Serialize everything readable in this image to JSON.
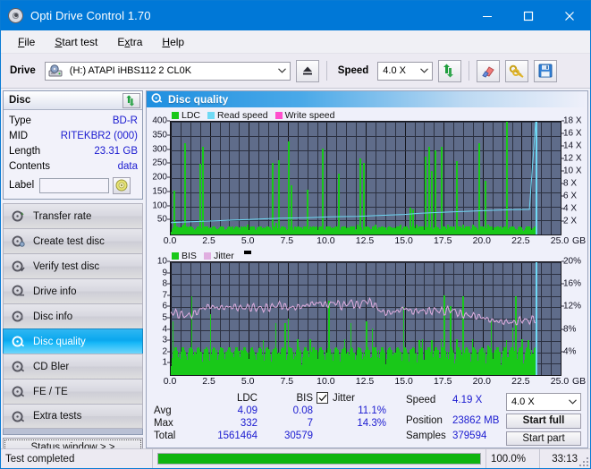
{
  "window": {
    "title": "Opti Drive Control 1.70",
    "icon": "disc-icon",
    "minimize": "–",
    "maximize": "□",
    "close": "✕"
  },
  "menu": {
    "items": [
      {
        "label": "File",
        "accel": "F"
      },
      {
        "label": "Start test",
        "accel": "S"
      },
      {
        "label": "Extra",
        "accel": "x"
      },
      {
        "label": "Help",
        "accel": "H"
      }
    ]
  },
  "toolbar": {
    "drive_label": "Drive",
    "drive_value": "(H:)  ATAPI iHBS112  2 CL0K",
    "eject_icon": "eject-icon",
    "speed_label": "Speed",
    "speed_value": "4.0 X",
    "refresh_icon": "refresh-icon",
    "erase_icon": "eraser-icon",
    "keys_icon": "keys-icon",
    "save_icon": "save-icon"
  },
  "disc_panel": {
    "title": "Disc",
    "refresh_icon": "refresh-icon",
    "rows": [
      {
        "key": "Type",
        "value": "BD-R"
      },
      {
        "key": "MID",
        "value": "RITEKBR2 (000)"
      },
      {
        "key": "Length",
        "value": "23.31 GB"
      },
      {
        "key": "Contents",
        "value": "data"
      }
    ],
    "label_key": "Label",
    "label_value": "",
    "label_placeholder": "",
    "label_button_icon": "disc-icon"
  },
  "sidebar": {
    "items": [
      {
        "label": "Transfer rate",
        "icon": "disc-test-icon",
        "selected": false
      },
      {
        "label": "Create test disc",
        "icon": "disc-write-icon",
        "selected": false
      },
      {
        "label": "Verify test disc",
        "icon": "disc-verify-icon",
        "selected": false
      },
      {
        "label": "Drive info",
        "icon": "drive-info-icon",
        "selected": false
      },
      {
        "label": "Disc info",
        "icon": "disc-info-icon",
        "selected": false
      },
      {
        "label": "Disc quality",
        "icon": "disc-quality-icon",
        "selected": true
      },
      {
        "label": "CD Bler",
        "icon": "cd-bler-icon",
        "selected": false
      },
      {
        "label": "FE / TE",
        "icon": "fe-te-icon",
        "selected": false
      },
      {
        "label": "Extra tests",
        "icon": "extra-tests-icon",
        "selected": false
      }
    ],
    "status_window_button": "Status window > >"
  },
  "panel": {
    "title": "Disc quality",
    "icon": "disc-quality-icon"
  },
  "stats": {
    "col_ldc": "LDC",
    "col_bis": "BIS",
    "jitter_label": "Jitter",
    "jitter_checked": true,
    "row_avg": "Avg",
    "row_max": "Max",
    "row_total": "Total",
    "ldc_avg": "4.09",
    "ldc_max": "332",
    "ldc_total": "1561464",
    "bis_avg": "0.08",
    "bis_max": "7",
    "bis_total": "30579",
    "jitter_avg": "11.1%",
    "jitter_max": "14.3%",
    "speed_label": "Speed",
    "speed_value": "4.19 X",
    "position_label": "Position",
    "position_value": "23862 MB",
    "samples_label": "Samples",
    "samples_value": "379594",
    "speed_select": "4.0 X",
    "start_full": "Start full",
    "start_part": "Start part"
  },
  "statusbar": {
    "message": "Test completed",
    "progress_text": "100.0%",
    "progress_value": 100,
    "elapsed": "33:13"
  },
  "colors": {
    "accent": "#0078d7",
    "ldc": "#19c819",
    "bis": "#19c819",
    "read_speed": "#6fd9f5",
    "write_speed": "#ff4ecd",
    "jitter": "#e0aee0",
    "plot_bg": "#5f6c8a",
    "value_text": "#1a1ad0"
  },
  "chart_data": [
    {
      "type": "line",
      "title": "LDC / Read speed",
      "xlabel": "GB",
      "ylabel": "LDC",
      "xlim": [
        0,
        25
      ],
      "xticks": [
        0.0,
        2.5,
        5.0,
        7.5,
        10.0,
        12.5,
        15.0,
        17.5,
        20.0,
        22.5,
        25.0
      ],
      "xticklabels": [
        "0.0",
        "2.5",
        "5.0",
        "7.5",
        "10.0",
        "12.5",
        "15.0",
        "17.5",
        "20.0",
        "22.5",
        "25.0"
      ],
      "xunit": "GB",
      "ylim": [
        0,
        400
      ],
      "yticks": [
        50,
        100,
        150,
        200,
        250,
        300,
        350,
        400
      ],
      "y2lim": [
        0,
        18
      ],
      "y2ticks": [
        2,
        4,
        6,
        8,
        10,
        12,
        14,
        16,
        18
      ],
      "y2ticklabels": [
        "2 X",
        "4 X",
        "6 X",
        "8 X",
        "10 X",
        "12 X",
        "14 X",
        "16 X",
        "18 X"
      ],
      "grid": true,
      "legend": [
        {
          "name": "LDC",
          "color": "#19c819"
        },
        {
          "name": "Read speed",
          "color": "#6fd9f5"
        },
        {
          "name": "Write speed",
          "color": "#ff4ecd"
        }
      ],
      "series": [
        {
          "name": "LDC",
          "type": "bar",
          "color": "#19c819",
          "x": [
            0.05,
            0.15,
            0.25,
            0.35,
            0.45,
            0.55,
            0.65,
            0.75,
            0.85,
            0.95,
            1.1,
            1.25,
            1.4,
            1.55,
            1.7,
            1.85,
            2.0,
            2.15,
            2.3,
            2.45,
            2.6,
            2.75,
            2.9,
            3.1,
            3.3,
            3.5,
            3.7,
            3.9,
            4.1,
            4.3,
            4.5,
            4.7,
            4.9,
            5.1,
            5.3,
            5.5,
            5.7,
            5.9,
            6.1,
            6.3,
            6.5,
            6.7,
            6.9,
            7.1,
            7.3,
            7.5,
            7.7,
            7.9,
            8.1,
            8.3,
            8.5,
            8.7,
            8.9,
            9.1,
            9.3,
            9.5,
            9.7,
            9.9,
            10.1,
            10.3,
            10.5,
            10.7,
            10.9,
            11.1,
            11.3,
            11.5,
            11.7,
            11.9,
            12.1,
            12.3,
            12.5,
            12.7,
            12.9,
            13.1,
            13.3,
            13.5,
            13.7,
            13.9,
            14.1,
            14.3,
            14.5,
            14.7,
            14.9,
            15.1,
            15.3,
            15.5,
            15.7,
            15.9,
            16.1,
            16.3,
            16.5,
            16.7,
            16.9,
            17.1,
            17.3,
            17.5,
            17.7,
            17.9,
            18.1,
            18.3,
            18.5,
            18.7,
            18.9,
            19.1,
            19.3,
            19.5,
            19.7,
            19.9,
            20.1,
            20.3,
            20.5,
            20.7,
            20.9,
            21.1,
            21.3,
            21.5,
            21.7,
            21.9,
            22.1,
            22.3,
            22.5,
            22.7,
            22.9,
            23.1,
            23.3
          ],
          "values": [
            20,
            155,
            40,
            30,
            25,
            25,
            25,
            35,
            325,
            30,
            25,
            25,
            20,
            20,
            25,
            250,
            310,
            30,
            25,
            25,
            20,
            25,
            20,
            25,
            25,
            20,
            25,
            30,
            25,
            25,
            30,
            25,
            35,
            25,
            30,
            25,
            25,
            25,
            30,
            25,
            255,
            40,
            265,
            30,
            25,
            330,
            175,
            30,
            25,
            25,
            30,
            160,
            30,
            25,
            30,
            25,
            305,
            30,
            25,
            25,
            30,
            215,
            25,
            30,
            25,
            25,
            30,
            35,
            270,
            255,
            30,
            25,
            30,
            35,
            25,
            30,
            25,
            25,
            25,
            25,
            30,
            35,
            30,
            30,
            95,
            90,
            35,
            30,
            30,
            275,
            310,
            225,
            300,
            25,
            310,
            30,
            35,
            25,
            30,
            260,
            30,
            35,
            25,
            30,
            35,
            25,
            325,
            30,
            190,
            35,
            30,
            25,
            30,
            30,
            25,
            400,
            25,
            20,
            20,
            20,
            20
          ]
        },
        {
          "name": "Read speed",
          "type": "line",
          "color": "#6fd9f5",
          "x": [
            0.0,
            1.0,
            2.0,
            3.0,
            4.0,
            5.0,
            6.0,
            7.0,
            8.0,
            9.0,
            10.0,
            11.0,
            12.0,
            13.0,
            14.0,
            15.0,
            16.0,
            17.0,
            18.0,
            19.0,
            20.0,
            21.0,
            22.0,
            23.0,
            23.4
          ],
          "values": [
            1.9,
            2.0,
            2.1,
            2.2,
            2.3,
            2.4,
            2.5,
            2.6,
            2.65,
            2.7,
            2.8,
            2.85,
            2.9,
            3.0,
            3.1,
            3.2,
            3.4,
            3.5,
            3.6,
            3.7,
            3.8,
            3.9,
            3.95,
            4.0,
            18.0
          ]
        }
      ]
    },
    {
      "type": "line",
      "title": "BIS / Jitter",
      "xlabel": "GB",
      "ylabel": "BIS",
      "xlim": [
        0,
        25
      ],
      "xticks": [
        0.0,
        2.5,
        5.0,
        7.5,
        10.0,
        12.5,
        15.0,
        17.5,
        20.0,
        22.5,
        25.0
      ],
      "xticklabels": [
        "0.0",
        "2.5",
        "5.0",
        "7.5",
        "10.0",
        "12.5",
        "15.0",
        "17.5",
        "20.0",
        "22.5",
        "25.0"
      ],
      "xunit": "GB",
      "ylim": [
        0,
        10
      ],
      "yticks": [
        1,
        2,
        3,
        4,
        5,
        6,
        7,
        8,
        9,
        10
      ],
      "y2lim": [
        0,
        20
      ],
      "y2ticks": [
        4,
        8,
        12,
        16,
        20
      ],
      "y2ticklabels": [
        "4%",
        "8%",
        "12%",
        "16%",
        "20%"
      ],
      "grid": true,
      "legend": [
        {
          "name": "BIS",
          "color": "#19c819"
        },
        {
          "name": "Jitter",
          "color": "#e0aee0"
        }
      ],
      "series": [
        {
          "name": "BIS",
          "type": "bar",
          "color": "#19c819",
          "x": [
            0.1,
            0.3,
            0.5,
            0.7,
            0.9,
            1.1,
            1.3,
            1.5,
            1.7,
            1.9,
            2.1,
            2.3,
            2.5,
            2.7,
            2.9,
            3.1,
            3.3,
            3.5,
            3.7,
            3.9,
            4.1,
            4.3,
            4.5,
            4.7,
            4.9,
            5.1,
            5.3,
            5.5,
            5.7,
            5.9,
            6.1,
            6.3,
            6.5,
            6.7,
            6.9,
            7.1,
            7.3,
            7.5,
            7.7,
            7.9,
            8.1,
            8.3,
            8.5,
            8.7,
            8.9,
            9.1,
            9.3,
            9.5,
            9.7,
            9.9,
            10.1,
            10.3,
            10.5,
            10.7,
            10.9,
            11.1,
            11.3,
            11.5,
            11.7,
            11.9,
            12.1,
            12.3,
            12.5,
            12.7,
            12.9,
            13.1,
            13.3,
            13.5,
            13.7,
            13.9,
            14.1,
            14.3,
            14.5,
            14.7,
            14.9,
            15.1,
            15.3,
            15.5,
            15.7,
            15.9,
            16.1,
            16.3,
            16.5,
            16.7,
            16.9,
            17.1,
            17.3,
            17.5,
            17.7,
            17.9,
            18.1,
            18.3,
            18.5,
            18.7,
            18.9,
            19.1,
            19.3,
            19.5,
            19.7,
            19.9,
            20.1,
            20.3,
            20.5,
            20.7,
            20.9,
            21.1,
            21.3,
            21.5,
            21.7,
            21.9,
            22.1,
            22.3,
            22.5,
            22.7,
            22.9,
            23.1,
            23.3
          ],
          "values": [
            4.8,
            2.4,
            2.0,
            1.9,
            2.1,
            2.0,
            7.0,
            2.1,
            2.0,
            2.1,
            2.0,
            2.2,
            5.4,
            2.0,
            2.2,
            2.0,
            2.0,
            2.1,
            2.2,
            2.0,
            2.1,
            2.0,
            2.2,
            2.1,
            2.0,
            2.0,
            2.1,
            2.0,
            2.2,
            3.1,
            2.0,
            2.2,
            2.1,
            4.6,
            2.0,
            2.2,
            4.6,
            5.0,
            2.1,
            2.0,
            3.2,
            2.2,
            2.1,
            2.0,
            3.2,
            2.0,
            2.2,
            2.1,
            2.0,
            2.2,
            6.6,
            2.0,
            2.1,
            2.2,
            2.0,
            3.2,
            2.1,
            4.6,
            2.0,
            2.2,
            2.1,
            2.0,
            4.8,
            2.2,
            4.1,
            2.0,
            2.2,
            2.1,
            2.0,
            2.2,
            2.1,
            2.0,
            2.2,
            2.1,
            6.0,
            2.0,
            2.2,
            2.1,
            2.0,
            3.1,
            3.2,
            2.2,
            2.1,
            3.1,
            2.0,
            2.2,
            3.2,
            7.1,
            2.1,
            6.1,
            2.0,
            3.2,
            2.2,
            7.0,
            2.1,
            2.0,
            3.2,
            2.2,
            2.1,
            2.0,
            2.2,
            2.6,
            4.9,
            2.0,
            2.2,
            2.1,
            2.0,
            3.1,
            2.2,
            4.2,
            7.0,
            2.1,
            3.2,
            2.0,
            3.1,
            2.2,
            2.0
          ]
        },
        {
          "name": "Jitter",
          "type": "line",
          "color": "#e0aee0",
          "x": [
            0.0,
            0.5,
            1.0,
            1.5,
            2.0,
            2.5,
            3.0,
            3.5,
            4.0,
            4.5,
            5.0,
            5.5,
            6.0,
            6.5,
            7.0,
            7.5,
            8.0,
            8.5,
            9.0,
            9.5,
            10.0,
            10.5,
            11.0,
            11.5,
            12.0,
            12.5,
            13.0,
            13.5,
            14.0,
            14.5,
            15.0,
            15.5,
            16.0,
            16.5,
            17.0,
            17.5,
            18.0,
            18.5,
            19.0,
            19.5,
            20.0,
            20.5,
            21.0,
            21.5,
            22.0,
            22.5,
            23.0,
            23.4
          ],
          "values": [
            11.2,
            10.8,
            10.5,
            10.8,
            11.8,
            12.2,
            11.9,
            12.0,
            12.1,
            11.9,
            12.0,
            11.9,
            11.8,
            12.1,
            12.5,
            11.9,
            12.0,
            12.2,
            12.6,
            12.8,
            12.4,
            12.9,
            12.2,
            12.9,
            12.3,
            13.2,
            12.6,
            11.2,
            11.0,
            11.3,
            11.9,
            11.2,
            11.4,
            11.3,
            11.5,
            11.3,
            11.6,
            10.9,
            10.6,
            10.5,
            10.2,
            9.7,
            9.5,
            9.4,
            9.3,
            9.8,
            9.6,
            10.0
          ]
        }
      ]
    }
  ]
}
